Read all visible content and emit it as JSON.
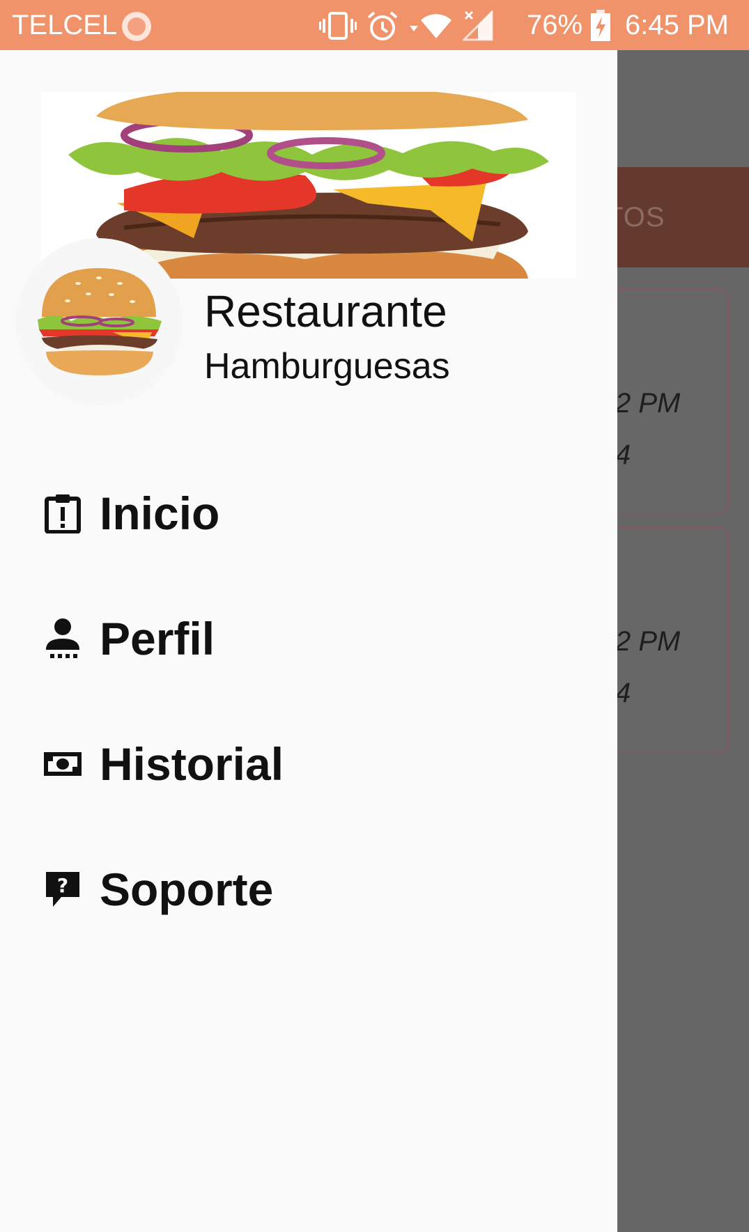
{
  "status_bar": {
    "carrier": "TELCEL",
    "battery_percent": "76%",
    "time": "6:45 PM",
    "icons": [
      "record-dot-icon",
      "vibrate-icon",
      "alarm-icon",
      "wifi-icon",
      "no-signal-icon",
      "battery-charging-icon"
    ]
  },
  "drawer": {
    "header": {
      "restaurant_name": "Restaurante",
      "restaurant_type": "Hamburguesas",
      "banner_image": "hamburger-photo",
      "avatar_image": "hamburger-photo"
    },
    "menu": [
      {
        "label": "Inicio",
        "icon": "clipboard-alert-icon"
      },
      {
        "label": "Perfil",
        "icon": "person-icon"
      },
      {
        "label": "Historial",
        "icon": "cash-icon"
      },
      {
        "label": "Soporte",
        "icon": "help-chat-icon"
      }
    ]
  },
  "background_app": {
    "tab_label_fragment": "TOS",
    "cards": [
      {
        "time_fragment": "2 PM",
        "number_fragment": "4"
      },
      {
        "time_fragment": "2 PM",
        "number_fragment": "4"
      }
    ]
  },
  "colors": {
    "status_bar": "#f0926a",
    "scrim": "#666666",
    "app_bar_dimmed": "#643a2e",
    "drawer_background": "#fafafa"
  }
}
